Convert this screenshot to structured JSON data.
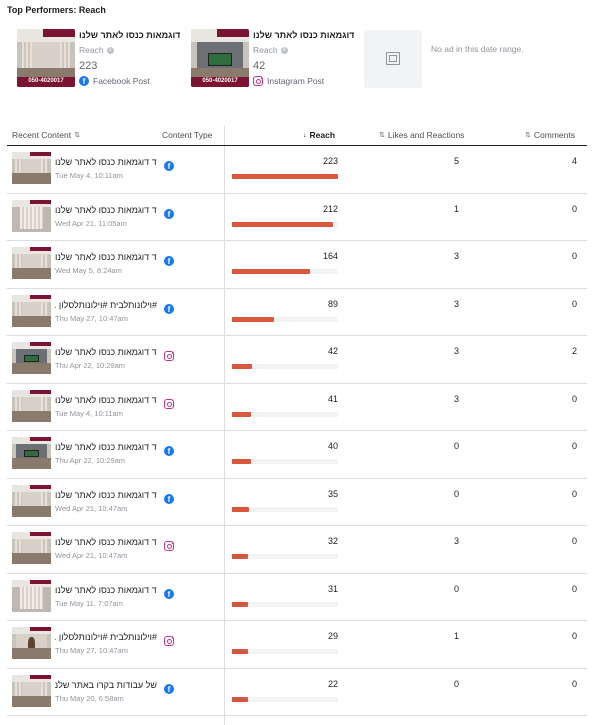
{
  "section_title": "Top Performers: Reach",
  "top_performers": [
    {
      "caption": "דוגמאות כנסו לאתר שלנו",
      "metric_label": "Reach",
      "value": "223",
      "platform": "Facebook Post",
      "platform_icon": "facebook-icon",
      "phone": "050-4020017"
    },
    {
      "caption": "דוגמאות כנסו לאתר שלנו",
      "metric_label": "Reach",
      "value": "42",
      "platform": "Instagram Post",
      "platform_icon": "instagram-icon",
      "phone": "050-4020017"
    }
  ],
  "empty_card": {
    "text": "No ad in this date range."
  },
  "table": {
    "columns": {
      "content": "Recent Content",
      "type": "Content Type",
      "reach": "Reach",
      "likes": "Likes and Reactions",
      "comments": "Comments"
    },
    "bar_color": "#d9573d",
    "max_reach": 223,
    "rows": [
      {
        "caption": "ד דוגמאות כנסו לאתר שלנו",
        "date": "Tue May 4, 10:11am",
        "type": "facebook",
        "reach": "223",
        "reach_value": 223,
        "likes": "5",
        "comments": "4",
        "thumb": "room"
      },
      {
        "caption": "ד דוגמאות כנסו לאתר שלנו",
        "date": "Wed Apr 21, 11:05am",
        "type": "facebook",
        "reach": "212",
        "reach_value": 212,
        "likes": "1",
        "comments": "0",
        "thumb": "tall"
      },
      {
        "caption": "ד דוגמאות כנסו לאתר שלנו",
        "date": "Wed May 5, 8:24am",
        "type": "facebook",
        "reach": "164",
        "reach_value": 164,
        "likes": "3",
        "comments": "0",
        "thumb": "room"
      },
      {
        "caption": "#וילונותלבית #וילונותלסלון ...",
        "date": "Thu May 27, 10:47am",
        "type": "facebook",
        "reach": "89",
        "reach_value": 89,
        "likes": "3",
        "comments": "0",
        "thumb": "room"
      },
      {
        "caption": "ד דוגמאות כנסו לאתר שלנו",
        "date": "Thu Apr 22, 10:29am",
        "type": "instagram",
        "reach": "42",
        "reach_value": 42,
        "likes": "3",
        "comments": "2",
        "thumb": "tv"
      },
      {
        "caption": "ד דוגמאות כנסו לאתר שלנו",
        "date": "Tue May 4, 10:11am",
        "type": "instagram",
        "reach": "41",
        "reach_value": 41,
        "likes": "3",
        "comments": "0",
        "thumb": "room"
      },
      {
        "caption": "ד דוגמאות כנסו לאתר שלנו",
        "date": "Thu Apr 22, 10:29am",
        "type": "facebook",
        "reach": "40",
        "reach_value": 40,
        "likes": "0",
        "comments": "0",
        "thumb": "tv"
      },
      {
        "caption": "ד דוגמאות כנסו לאתר שלנו",
        "date": "Wed Apr 21, 10:47am",
        "type": "facebook",
        "reach": "35",
        "reach_value": 35,
        "likes": "0",
        "comments": "0",
        "thumb": "room"
      },
      {
        "caption": "ד דוגמאות כנסו לאתר שלנו",
        "date": "Wed Apr 21, 10:47am",
        "type": "instagram",
        "reach": "32",
        "reach_value": 32,
        "likes": "3",
        "comments": "0",
        "thumb": "room"
      },
      {
        "caption": "ד דוגמאות כנסו לאתר שלנו",
        "date": "Tue May 11, 7:07am",
        "type": "facebook",
        "reach": "31",
        "reach_value": 31,
        "likes": "0",
        "comments": "0",
        "thumb": "tall"
      },
      {
        "caption": "#וילונותלבית #וילונותלסלון ...",
        "date": "Thu May 27, 10:47am",
        "type": "instagram",
        "reach": "29",
        "reach_value": 29,
        "likes": "1",
        "comments": "0",
        "thumb": "person"
      },
      {
        "caption": "של עבודות בקרו באתר שלנו",
        "date": "Thu May 20, 6:58am",
        "type": "facebook",
        "reach": "22",
        "reach_value": 22,
        "likes": "0",
        "comments": "0",
        "thumb": "room"
      }
    ]
  }
}
